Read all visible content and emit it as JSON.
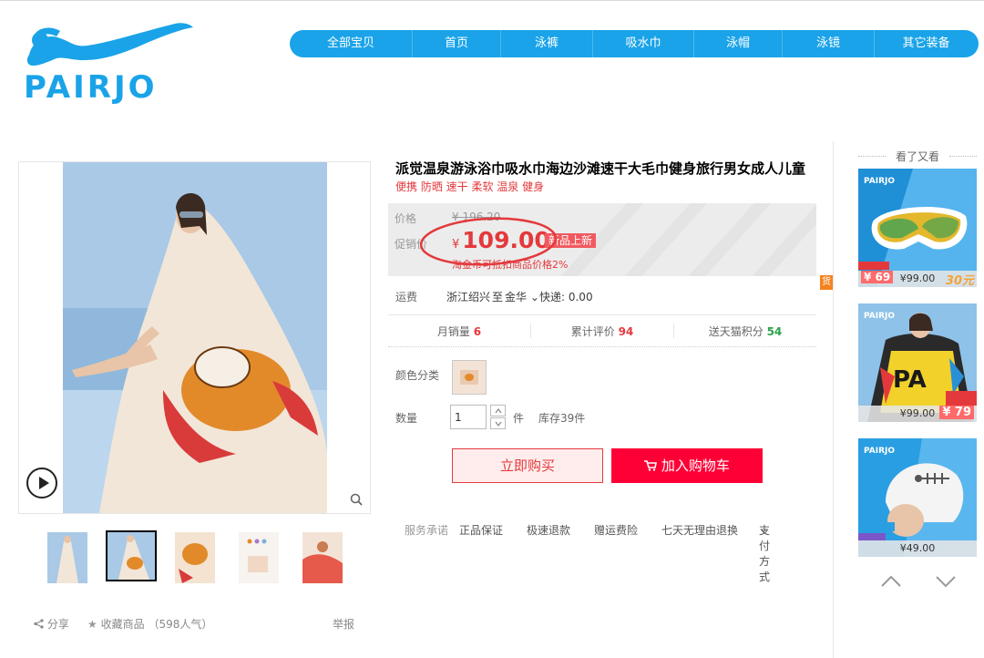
{
  "logo": {
    "brand_text": "PAIRJO"
  },
  "nav": {
    "items": [
      {
        "label": "全部宝贝",
        "width": 134
      },
      {
        "label": "首页",
        "width": 96
      },
      {
        "label": "泳裤",
        "width": 100
      },
      {
        "label": "吸水巾",
        "width": 110
      },
      {
        "label": "泳帽",
        "width": 96
      },
      {
        "label": "泳镜",
        "width": 100
      },
      {
        "label": "其它装备",
        "width": 113
      }
    ]
  },
  "product": {
    "title": "派觉温泉游泳浴巾吸水巾海边沙滩速干大毛巾健身旅行男女成人儿童",
    "subtitle": "便携 防晒 速干 柔软 温泉 健身",
    "price_label": "价格",
    "price_original": "¥ 196.20",
    "promo_label": "促销价",
    "promo_currency": "¥",
    "promo_price": "109.00",
    "new_badge": "新品上新",
    "coin_note": "淘金币可抵扣商品价格2%",
    "shipping_label": "运费",
    "shipping_from": "浙江绍兴",
    "shipping_to_label": "至",
    "shipping_to": "金华",
    "shipping_fee": "快递: 0.00",
    "stats": {
      "monthly_sales_label": "月销量",
      "monthly_sales_value": "6",
      "reviews_label": "累计评价",
      "reviews_value": "94",
      "points_label": "送天猫积分",
      "points_value": "54"
    },
    "color_label": "颜色分类",
    "qty_label": "数量",
    "qty_value": "1",
    "qty_unit": "件",
    "stock": "库存39件",
    "buy_now": "立即购买",
    "add_to_cart": "加入购物车"
  },
  "service": {
    "label": "服务承诺",
    "items": [
      "正品保证",
      "极速退款",
      "赠运费险",
      "七天无理由退换"
    ],
    "payment": "支付方式"
  },
  "gallery": {
    "share": "分享",
    "favorite": "收藏商品",
    "popularity": "（598人气）",
    "report": "举报"
  },
  "sidebar": {
    "title": "看了又看",
    "cards": [
      {
        "price": "¥99.00",
        "tag_left": "¥ 69",
        "tag_right": "30元"
      },
      {
        "price": "¥99.00",
        "tag_left": "¥ 79",
        "tag_right": "¥ 79"
      },
      {
        "price": "¥49.00",
        "tag_left": "",
        "tag_right": ""
      }
    ]
  },
  "colors": {
    "brand_blue": "#1aa3e8",
    "accent_red": "#e4393c",
    "cart_red": "#ff0036"
  }
}
